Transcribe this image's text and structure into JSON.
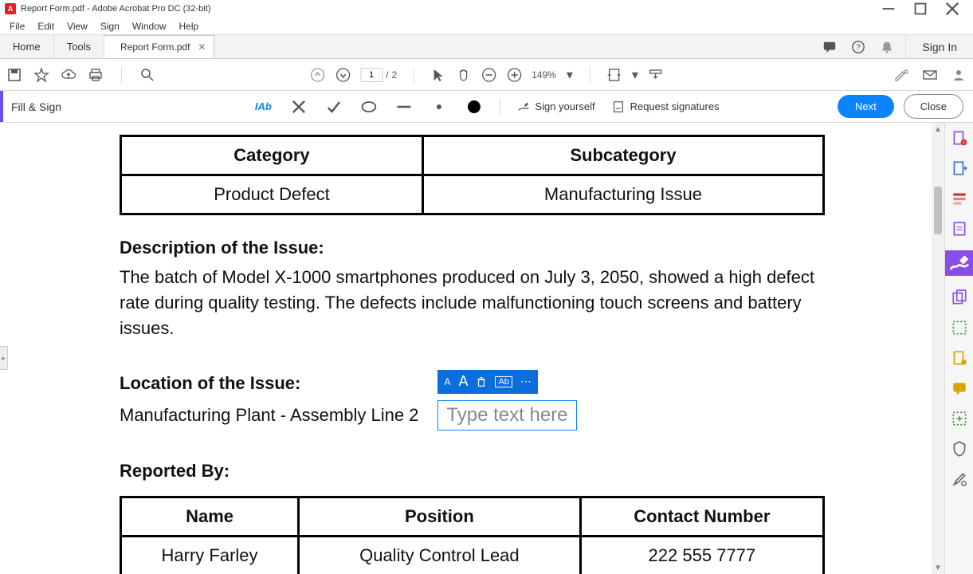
{
  "window": {
    "title": "Report Form.pdf - Adobe Acrobat Pro DC (32-bit)"
  },
  "menu": {
    "file": "File",
    "edit": "Edit",
    "view": "View",
    "sign": "Sign",
    "window": "Window",
    "help": "Help"
  },
  "tabs": {
    "home": "Home",
    "tools": "Tools",
    "doc": "Report Form.pdf",
    "signin": "Sign In"
  },
  "toolbar": {
    "page_current": "1",
    "page_sep": "/",
    "page_total": "2",
    "zoom": "149%"
  },
  "fillsign": {
    "label": "Fill & Sign",
    "text_tool": "IAb",
    "sign_yourself": "Sign yourself",
    "request_signatures": "Request signatures",
    "next": "Next",
    "close": "Close"
  },
  "document": {
    "table1": {
      "headers": [
        "Category",
        "Subcategory"
      ],
      "row": [
        "Product Defect",
        "Manufacturing Issue"
      ]
    },
    "desc_heading": "Description of the Issue:",
    "desc_body": "The batch of Model X-1000 smartphones produced on July 3, 2050, showed a high defect rate during quality testing. The defects include malfunctioning touch screens and battery issues.",
    "loc_heading": "Location of the Issue:",
    "loc_value": "Manufacturing Plant - Assembly Line 2",
    "type_placeholder": "Type text here",
    "reported_heading": "Reported By:",
    "table2": {
      "headers": [
        "Name",
        "Position",
        "Contact Number"
      ],
      "row": [
        "Harry Farley",
        "Quality Control Lead",
        "222 555 7777"
      ]
    },
    "text_toolbar": {
      "small_a": "A",
      "big_a": "A",
      "ab": "Ab",
      "more": "⋯"
    }
  }
}
